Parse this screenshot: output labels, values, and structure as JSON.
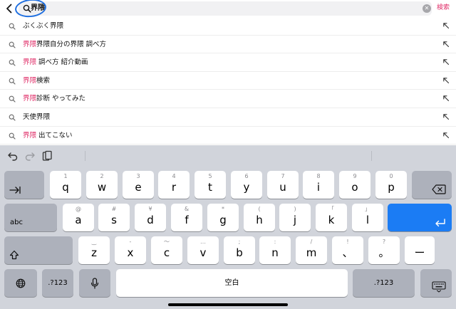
{
  "search": {
    "query": "界隈",
    "action_label": "検索"
  },
  "suggestions": [
    {
      "highlight": "",
      "rest": "ぶくぶく界隈"
    },
    {
      "highlight": "界隈",
      "rest": "界隈自分の界隈 調べ方"
    },
    {
      "highlight": "界隈",
      "rest": " 調べ方 紹介動画"
    },
    {
      "highlight": "界隈",
      "rest": "検索"
    },
    {
      "highlight": "界隈",
      "rest": "診断 やってみた"
    },
    {
      "highlight": "",
      "rest": "天使界隈"
    },
    {
      "highlight": "界隈",
      "rest": " 出てこない"
    }
  ],
  "keyboard": {
    "row1": [
      {
        "sub": "1",
        "main": "q"
      },
      {
        "sub": "2",
        "main": "w"
      },
      {
        "sub": "3",
        "main": "e"
      },
      {
        "sub": "4",
        "main": "r"
      },
      {
        "sub": "5",
        "main": "t"
      },
      {
        "sub": "6",
        "main": "y"
      },
      {
        "sub": "7",
        "main": "u"
      },
      {
        "sub": "8",
        "main": "i"
      },
      {
        "sub": "9",
        "main": "o"
      },
      {
        "sub": "0",
        "main": "p"
      }
    ],
    "row2": [
      {
        "sub": "@",
        "main": "a"
      },
      {
        "sub": "#",
        "main": "s"
      },
      {
        "sub": "¥",
        "main": "d"
      },
      {
        "sub": "&",
        "main": "f"
      },
      {
        "sub": "*",
        "main": "g"
      },
      {
        "sub": "(",
        "main": "h"
      },
      {
        "sub": ")",
        "main": "j"
      },
      {
        "sub": "「",
        "main": "k"
      },
      {
        "sub": "」",
        "main": "l"
      }
    ],
    "row3": [
      {
        "sub": "‿",
        "main": "z"
      },
      {
        "sub": "-",
        "main": "x"
      },
      {
        "sub": "〜",
        "main": "c"
      },
      {
        "sub": "…",
        "main": "v"
      },
      {
        "sub": ";",
        "main": "b"
      },
      {
        "sub": ":",
        "main": "n"
      },
      {
        "sub": "/",
        "main": "m"
      },
      {
        "sub": "!",
        "main": "、"
      },
      {
        "sub": "?",
        "main": "。"
      },
      {
        "sub": "",
        "main": "ー"
      }
    ],
    "abc_label": "abc",
    "numbers_label": ".?123",
    "space_label": "空白"
  },
  "colors": {
    "highlight": "#e0306a",
    "action": "#e0306a",
    "return_key": "#1b7cf4",
    "keyboard_bg": "#d1d4db",
    "annotation_circle": "#1f6fe0"
  },
  "icons": {
    "back": "chevron-left-icon",
    "search": "magnifier-icon",
    "clear": "clear-x-icon",
    "fill": "arrow-up-left-icon",
    "undo": "undo-icon",
    "redo": "redo-icon",
    "paste": "clipboard-icon",
    "tab": "tab-arrow-icon",
    "delete": "delete-backward-icon",
    "shift": "shift-arrow-icon",
    "return": "return-arrow-icon",
    "globe": "globe-icon",
    "mic": "microphone-icon",
    "hide_keyboard": "keyboard-dismiss-icon"
  }
}
